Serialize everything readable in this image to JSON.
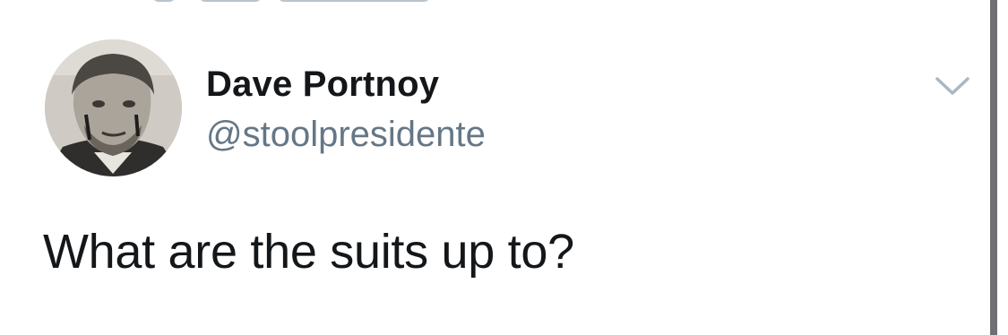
{
  "tweet": {
    "author": {
      "display_name": "Dave Portnoy",
      "handle": "@stoolpresidente",
      "avatar_icon": "profile-photo"
    },
    "text": "What are the suits up to?",
    "menu_icon": "chevron-down-icon"
  },
  "colors": {
    "text_primary": "#14171a",
    "text_secondary": "#657786",
    "chevron": "#aab8c2",
    "background": "#ffffff",
    "edge_bar": "#6f6f74"
  }
}
